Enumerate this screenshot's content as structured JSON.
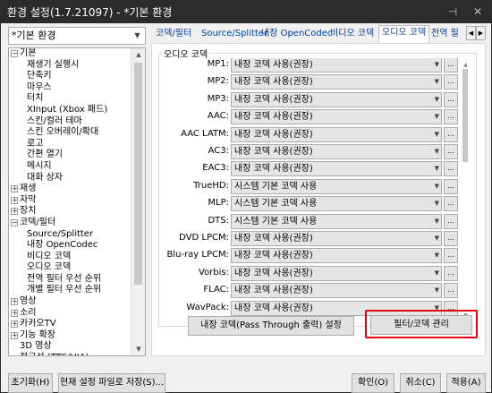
{
  "window": {
    "title": "환경 설정(1.7.21097) - *기본 환경",
    "pin_glyph": "⊣",
    "close_glyph": "✕"
  },
  "profile": {
    "selected": "*기본 환경"
  },
  "tree": [
    {
      "label": "기본",
      "level": 0,
      "expander": "−"
    },
    {
      "label": "재생기 실행시",
      "level": 1
    },
    {
      "label": "단축키",
      "level": 1
    },
    {
      "label": "마우스",
      "level": 1
    },
    {
      "label": "터치",
      "level": 1
    },
    {
      "label": "XInput (Xbox 패드)",
      "level": 1
    },
    {
      "label": "스킨/컬러 테마",
      "level": 1
    },
    {
      "label": "스킨 오버레이/확대",
      "level": 1
    },
    {
      "label": "로고",
      "level": 1
    },
    {
      "label": "간편 열기",
      "level": 1
    },
    {
      "label": "메시지",
      "level": 1
    },
    {
      "label": "대화 상자",
      "level": 1
    },
    {
      "label": "재생",
      "level": 0,
      "expander": "+"
    },
    {
      "label": "자막",
      "level": 0,
      "expander": "+"
    },
    {
      "label": "장치",
      "level": 0,
      "expander": "+"
    },
    {
      "label": "코덱/필터",
      "level": 0,
      "expander": "−"
    },
    {
      "label": "Source/Splitter",
      "level": 1
    },
    {
      "label": "내장 OpenCodec",
      "level": 1
    },
    {
      "label": "비디오 코덱",
      "level": 1
    },
    {
      "label": "오디오 코덱",
      "level": 1
    },
    {
      "label": "전역 필터 우선 순위",
      "level": 1
    },
    {
      "label": "개별 필터 우선 순위",
      "level": 1
    },
    {
      "label": "영상",
      "level": 0,
      "expander": "+"
    },
    {
      "label": "소리",
      "level": 0,
      "expander": "+"
    },
    {
      "label": "카카오TV",
      "level": 0,
      "expander": "+"
    },
    {
      "label": "기능 확장",
      "level": 0,
      "expander": "+"
    },
    {
      "label": "3D 영상",
      "level": 0
    },
    {
      "label": "접근성 (TTS/UIA)",
      "level": 0
    }
  ],
  "tabs": [
    {
      "label": "코덱/필터",
      "active": false
    },
    {
      "label": "Source/Splitter",
      "active": false
    },
    {
      "label": "내장 OpenCodec",
      "active": false
    },
    {
      "label": "비디오 코덱",
      "active": false
    },
    {
      "label": "오디오 코덱",
      "active": true
    },
    {
      "label": "전역 필",
      "active": false
    }
  ],
  "tab_arrows": {
    "left": "◀",
    "right": "▶"
  },
  "group_title": "오디오 코덱",
  "codecs": [
    {
      "label": "MP1:",
      "value": "내장 코덱 사용(권장)"
    },
    {
      "label": "MP2:",
      "value": "내장 코덱 사용(권장)"
    },
    {
      "label": "MP3:",
      "value": "내장 코덱 사용(권장)"
    },
    {
      "label": "AAC:",
      "value": "내장 코덱 사용(권장)"
    },
    {
      "label": "AAC LATM:",
      "value": "내장 코덱 사용(권장)"
    },
    {
      "label": "AC3:",
      "value": "내장 코덱 사용(권장)"
    },
    {
      "label": "EAC3:",
      "value": "내장 코덱 사용(권장)"
    },
    {
      "label": "TrueHD:",
      "value": "시스템 기본 코덱 사용"
    },
    {
      "label": "MLP:",
      "value": "시스템 기본 코덱 사용"
    },
    {
      "label": "DTS:",
      "value": "시스템 기본 코덱 사용"
    },
    {
      "label": "DVD LPCM:",
      "value": "내장 코덱 사용(권장)"
    },
    {
      "label": "Blu-ray LPCM:",
      "value": "내장 코덱 사용(권장)"
    },
    {
      "label": "Vorbis:",
      "value": "내장 코덱 사용(권장)"
    },
    {
      "label": "FLAC:",
      "value": "내장 코덱 사용(권장)"
    },
    {
      "label": "WavPack:",
      "value": "내장 코덱 사용(권장)"
    }
  ],
  "more_button": "...",
  "passthrough_button": "내장 코덱(Pass Through 출력) 설정",
  "manage_button": "필터/코덱 관리",
  "bottom": {
    "reset": {
      "text": "초기화",
      "accel": "(H)"
    },
    "save": {
      "text": "현재 설정 파일로 저장",
      "accel": "(S)..."
    },
    "ok": {
      "text": "확인",
      "accel": "(O)"
    },
    "cancel": {
      "text": "취소",
      "accel": "(C)"
    },
    "apply": {
      "text": "적용",
      "accel": "(A)"
    }
  }
}
